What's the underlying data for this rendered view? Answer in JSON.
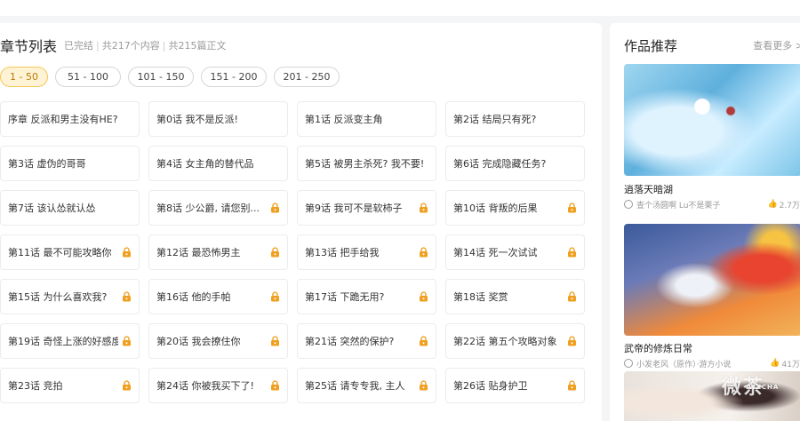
{
  "header": {
    "title": "章节列表",
    "status": "已完结",
    "total_content": "共217个内容",
    "total_main": "共215篇正文"
  },
  "tabs": [
    "1 - 50",
    "51 - 100",
    "101 - 150",
    "151 - 200",
    "201 - 250"
  ],
  "active_tab": "1 - 50",
  "chapters": [
    {
      "label": "序章 反派和男主没有HE?",
      "locked": false
    },
    {
      "label": "第0话 我不是反派!",
      "locked": false
    },
    {
      "label": "第1话 反派变主角",
      "locked": false
    },
    {
      "label": "第2话 结局只有死?",
      "locked": false
    },
    {
      "label": "第3话 虚伪的哥哥",
      "locked": false
    },
    {
      "label": "第4话 女主角的替代品",
      "locked": false
    },
    {
      "label": "第5话 被男主杀死? 我不要!",
      "locked": false
    },
    {
      "label": "第6话 完成隐藏任务?",
      "locked": false
    },
    {
      "label": "第7话 该认怂就认怂",
      "locked": false
    },
    {
      "label": "第8话 少公爵, 请您别...",
      "locked": true
    },
    {
      "label": "第9话 我可不是软柿子",
      "locked": true
    },
    {
      "label": "第10话 背叛的后果",
      "locked": true
    },
    {
      "label": "第11话 最不可能攻略你",
      "locked": true
    },
    {
      "label": "第12话 最恐怖男主",
      "locked": true
    },
    {
      "label": "第13话 把手给我",
      "locked": true
    },
    {
      "label": "第14话 死一次试试",
      "locked": true
    },
    {
      "label": "第15话 为什么喜欢我?",
      "locked": true
    },
    {
      "label": "第16话 他的手帕",
      "locked": true
    },
    {
      "label": "第17话 下跪无用?",
      "locked": true
    },
    {
      "label": "第18话 奖赏",
      "locked": true
    },
    {
      "label": "第19话 奇怪上涨的好感度",
      "locked": true
    },
    {
      "label": "第20话 我会撩住你",
      "locked": true
    },
    {
      "label": "第21话 突然的保护?",
      "locked": true
    },
    {
      "label": "第22话 第五个攻略对象",
      "locked": true
    },
    {
      "label": "第23话 竞拍",
      "locked": true
    },
    {
      "label": "第24话 你被我买下了!",
      "locked": true
    },
    {
      "label": "第25话 请专专我, 主人",
      "locked": true
    },
    {
      "label": "第26话 贴身护卫",
      "locked": true
    }
  ],
  "sidebar": {
    "title": "作品推荐",
    "more": "查看更多 >",
    "works": [
      {
        "title": "逍落天暗湖",
        "author": "查个汤圆啊 Lu不是栗子",
        "likes": "2.7万"
      },
      {
        "title": "武帝的修炼日常",
        "author": "小发老风（原作）·游方小说",
        "likes": "41万"
      }
    ]
  },
  "watermark": {
    "text": "微茶",
    "sub": "WXCHA"
  },
  "colors": {
    "active_tab_bg": "#fff3d6",
    "active_tab_border": "#f5c65a",
    "lock": "#f0a020"
  }
}
